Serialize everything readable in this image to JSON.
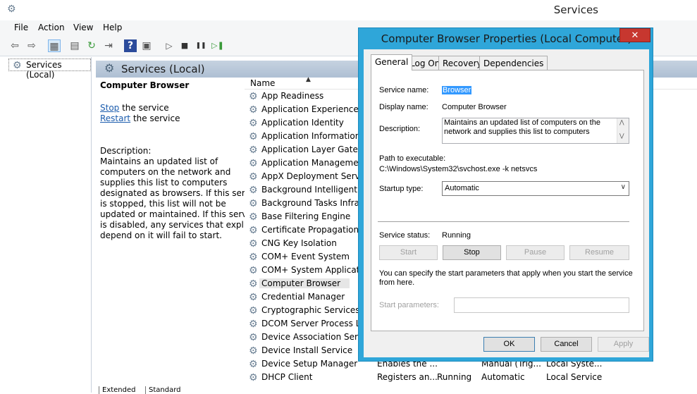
{
  "window": {
    "title": "Services"
  },
  "menu": [
    "File",
    "Action",
    "View",
    "Help"
  ],
  "toolbar": {
    "buttons": [
      "back-icon",
      "forward-icon",
      "show-tree-icon",
      "properties-icon",
      "refresh-icon",
      "export-icon",
      "help-icon",
      "console-icon",
      "play-icon",
      "stop-icon",
      "pause-icon",
      "resume-icon"
    ],
    "glyphs": [
      "⇦",
      "⇨",
      "▦",
      "▤",
      "↻",
      "⇥",
      "?",
      "▣",
      "▷",
      "■",
      "❚❚",
      "▷❚"
    ]
  },
  "tree": {
    "root": "Services (Local)"
  },
  "pane": {
    "title": "Services (Local)"
  },
  "details": {
    "service_name": "Computer Browser",
    "stop_link": "Stop",
    "stop_suffix": " the service",
    "restart_link": "Restart",
    "restart_suffix": " the service",
    "description_label": "Description:",
    "description_lines": [
      "Maintains an updated list of",
      "computers on the network and",
      "supplies this list to computers",
      "designated as browsers. If this service",
      "is stopped, this list will not be",
      "updated or maintained. If this service",
      "is disabled, any services that explicitly",
      "depend on it will fail to start."
    ]
  },
  "list": {
    "header": "Name",
    "rows": [
      {
        "name": "App Readiness"
      },
      {
        "name": "Application Experience"
      },
      {
        "name": "Application Identity"
      },
      {
        "name": "Application Information"
      },
      {
        "name": "Application Layer Gateway"
      },
      {
        "name": "Application Management"
      },
      {
        "name": "AppX Deployment Service"
      },
      {
        "name": "Background Intelligent Tra"
      },
      {
        "name": "Background Tasks Infrastr"
      },
      {
        "name": "Base Filtering Engine"
      },
      {
        "name": "Certificate Propagation"
      },
      {
        "name": "CNG Key Isolation"
      },
      {
        "name": "COM+ Event System"
      },
      {
        "name": "COM+ System Application"
      },
      {
        "name": "Computer Browser",
        "selected": true
      },
      {
        "name": "Credential Manager"
      },
      {
        "name": "Cryptographic Services"
      },
      {
        "name": "DCOM Server Process Lau"
      },
      {
        "name": "Device Association Service"
      },
      {
        "name": "Device Install Service"
      },
      {
        "name": "Device Setup Manager",
        "description": "Enables the ...",
        "status": "",
        "startup": "Manual (Trig...",
        "logon": "Local Syste..."
      },
      {
        "name": "DHCP Client",
        "description": "Registers an...",
        "status": "Running",
        "startup": "Automatic",
        "logon": "Local Service"
      }
    ]
  },
  "bottom_tabs": [
    "Extended",
    "Standard"
  ],
  "dialog": {
    "title": "Computer Browser Properties (Local Computer)",
    "close_glyph": "✕",
    "tabs": [
      "General",
      "Log On",
      "Recovery",
      "Dependencies"
    ],
    "active_tab": "General",
    "service_name_label": "Service name:",
    "service_name_value": "Browser",
    "display_name_label": "Display name:",
    "display_name_value": "Computer Browser",
    "description_label": "Description:",
    "description_value": "Maintains an updated list of computers on the network and supplies this list to computers",
    "path_label": "Path to executable:",
    "path_value": "C:\\Windows\\System32\\svchost.exe -k netsvcs",
    "startup_type_label": "Startup type:",
    "startup_type_value": "Automatic",
    "service_status_label": "Service status:",
    "service_status_value": "Running",
    "buttons": {
      "start": "Start",
      "stop": "Stop",
      "pause": "Pause",
      "resume": "Resume"
    },
    "hint": "You can specify the start parameters that apply when you start the service",
    "hint2": "from here.",
    "start_params_label": "Start parameters:",
    "start_params_value": "",
    "footer": {
      "ok": "OK",
      "cancel": "Cancel",
      "apply": "Apply"
    }
  }
}
